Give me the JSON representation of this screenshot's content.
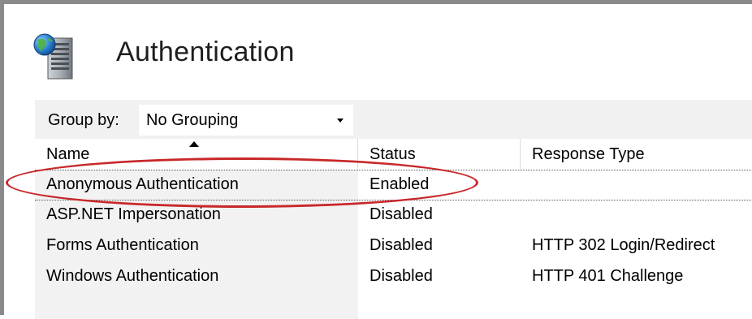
{
  "header": {
    "title": "Authentication",
    "icon": "server-globe-icon"
  },
  "toolbar": {
    "group_by_label": "Group by:",
    "group_by_value": "No Grouping"
  },
  "grid": {
    "columns": [
      "Name",
      "Status",
      "Response Type"
    ],
    "sort_column": "Name",
    "sort_direction": "ascending",
    "rows": [
      {
        "name": "Anonymous Authentication",
        "status": "Enabled",
        "response_type": ""
      },
      {
        "name": "ASP.NET Impersonation",
        "status": "Disabled",
        "response_type": ""
      },
      {
        "name": "Forms Authentication",
        "status": "Disabled",
        "response_type": "HTTP 302 Login/Redirect"
      },
      {
        "name": "Windows Authentication",
        "status": "Disabled",
        "response_type": "HTTP 401 Challenge"
      }
    ],
    "selected_row": "Anonymous Authentication"
  },
  "colors": {
    "highlight": "#c8282a",
    "toolbar_bg": "#f1f1f1",
    "name_column_bg": "#f2f2f2"
  }
}
